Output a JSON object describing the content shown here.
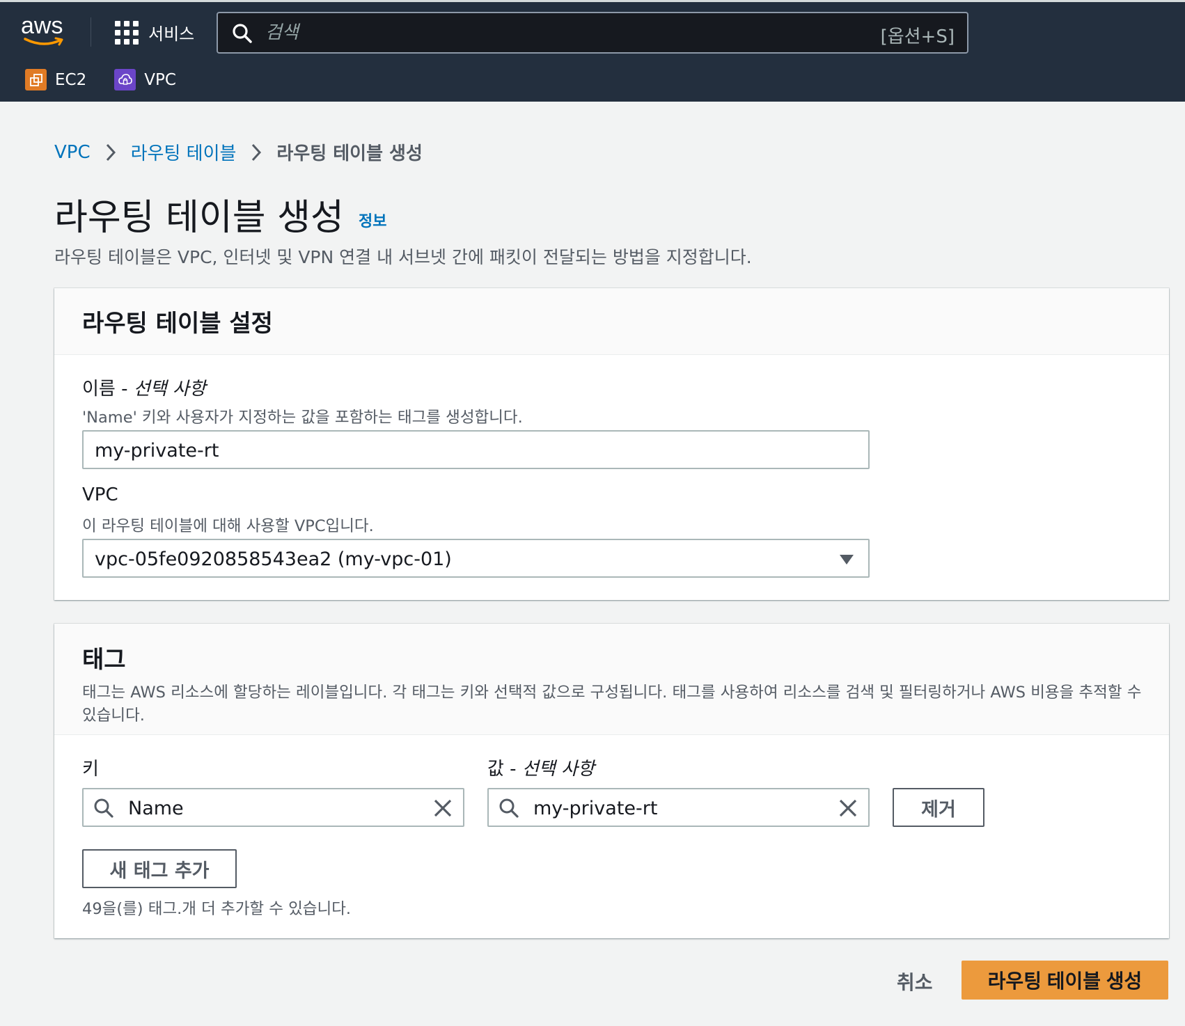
{
  "topnav": {
    "logo_text": "aws",
    "services_label": "서비스",
    "search_placeholder": "검색",
    "search_shortcut": "[옵션+S]",
    "favorites": [
      {
        "label": "EC2",
        "icon": "ec2-service-icon",
        "color": "#e07b25"
      },
      {
        "label": "VPC",
        "icon": "vpc-service-icon",
        "color": "#6b45c8"
      }
    ]
  },
  "breadcrumb": {
    "items": [
      "VPC",
      "라우팅 테이블",
      "라우팅 테이블 생성"
    ]
  },
  "header": {
    "title": "라우팅 테이블 생성",
    "info_link": "정보",
    "description": "라우팅 테이블은 VPC, 인터넷 및 VPN 연결 내 서브넷 간에 패킷이 전달되는 방법을 지정합니다."
  },
  "settings": {
    "title": "라우팅 테이블 설정",
    "name_label": "이름 - ",
    "name_label_optional": "선택 사항",
    "name_hint": "'Name' 키와 사용자가 지정하는 값을 포함하는 태그를 생성합니다.",
    "name_value": "my-private-rt",
    "vpc_label": "VPC",
    "vpc_hint": "이 라우팅 테이블에 대해 사용할 VPC입니다.",
    "vpc_value": "vpc-05fe0920858543ea2 (my-vpc-01)"
  },
  "tags": {
    "title": "태그",
    "description": "태그는 AWS 리소스에 할당하는 레이블입니다. 각 태그는 키와 선택적 값으로 구성됩니다. 태그를 사용하여 리소스를 검색 및 필터링하거나 AWS 비용을 추적할 수 있습니다.",
    "key_label": "키",
    "value_label": "값 - ",
    "value_label_optional": "선택 사항",
    "rows": [
      {
        "key": "Name",
        "value": "my-private-rt"
      }
    ],
    "remove_label": "제거",
    "add_label": "새 태그 추가",
    "limit_text": "49을(를) 태그.개 더 추가할 수 있습니다."
  },
  "actions": {
    "cancel_label": "취소",
    "submit_label": "라우팅 테이블 생성"
  },
  "colors": {
    "nav_bg": "#232f3e",
    "link": "#0073bb",
    "primary_button": "#ec9a3d"
  }
}
